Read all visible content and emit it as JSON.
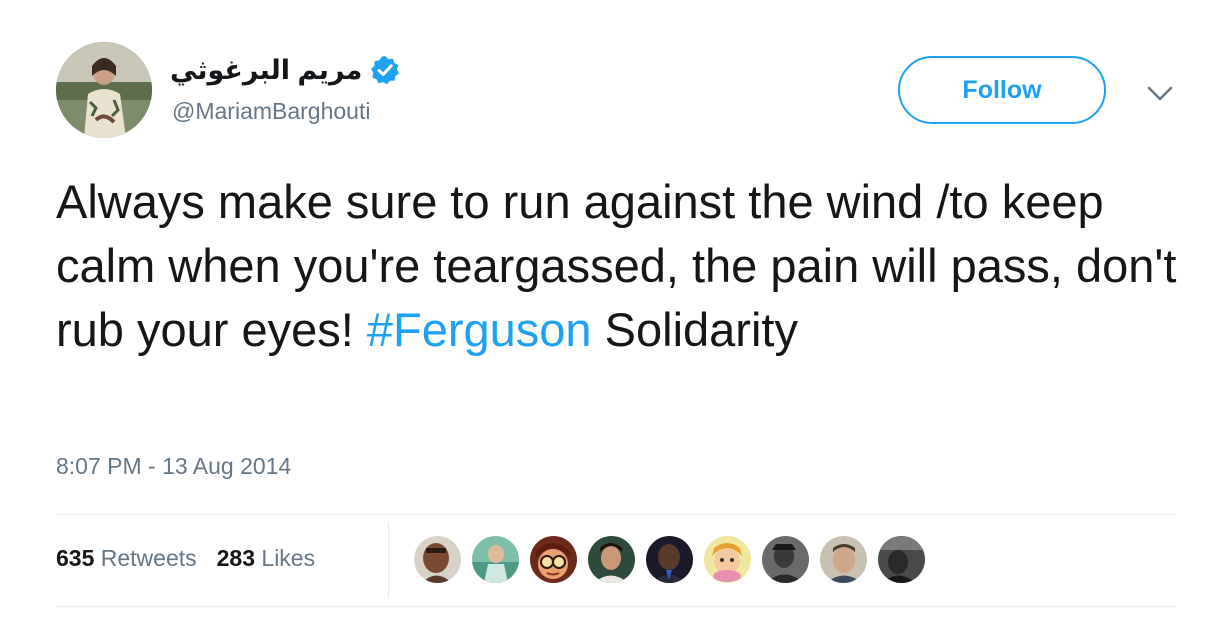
{
  "user": {
    "display_name": "مريم البرغوثي",
    "handle": "@MariamBarghouti",
    "verified": true
  },
  "actions": {
    "follow_label": "Follow"
  },
  "tweet": {
    "text_before": "Always make sure to run against the wind /to keep calm when you're teargassed, the pain will pass, don't rub your eyes! ",
    "hashtag": "#Ferguson",
    "text_after": " Solidarity",
    "timestamp": "8:07 PM - 13 Aug 2014"
  },
  "stats": {
    "retweets_count": "635",
    "retweets_label": "Retweets",
    "likes_count": "283",
    "likes_label": "Likes"
  },
  "colors": {
    "accent": "#1da1f2",
    "text": "#14171a",
    "secondary": "#657786",
    "divider": "#e6ecf0"
  },
  "facepile": [
    {
      "icon": "avatar-photo-man"
    },
    {
      "icon": "avatar-photo-figure"
    },
    {
      "icon": "avatar-cartoon-glasses"
    },
    {
      "icon": "avatar-photo-man"
    },
    {
      "icon": "avatar-photo-man"
    },
    {
      "icon": "avatar-cartoon-character"
    },
    {
      "icon": "avatar-photo-bw"
    },
    {
      "icon": "avatar-photo-man"
    },
    {
      "icon": "avatar-photo-bw"
    }
  ]
}
